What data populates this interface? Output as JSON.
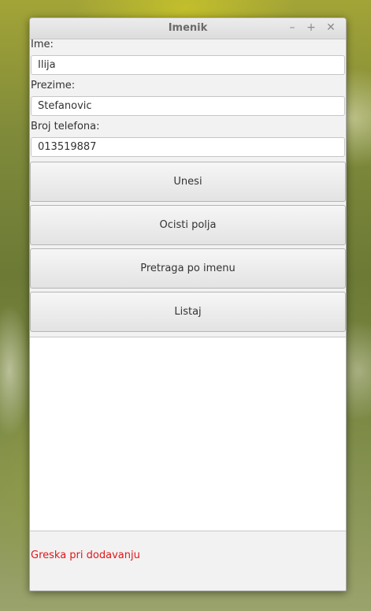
{
  "window": {
    "title": "Imenik"
  },
  "form": {
    "ime_label": "Ime:",
    "ime_value": "Ilija",
    "prezime_label": "Prezime:",
    "prezime_value": "Stefanovic",
    "telefon_label": "Broj telefona:",
    "telefon_value": "013519887"
  },
  "buttons": {
    "unesi": "Unesi",
    "ocisti": "Ocisti polja",
    "pretraga": "Pretraga po imenu",
    "listaj": "Listaj"
  },
  "list": {
    "items": []
  },
  "status": {
    "message": "Greska pri dodavanju",
    "color": "#e0161a"
  },
  "icons": {
    "minimize": "minimize-icon",
    "maximize": "maximize-icon",
    "close": "close-icon"
  }
}
